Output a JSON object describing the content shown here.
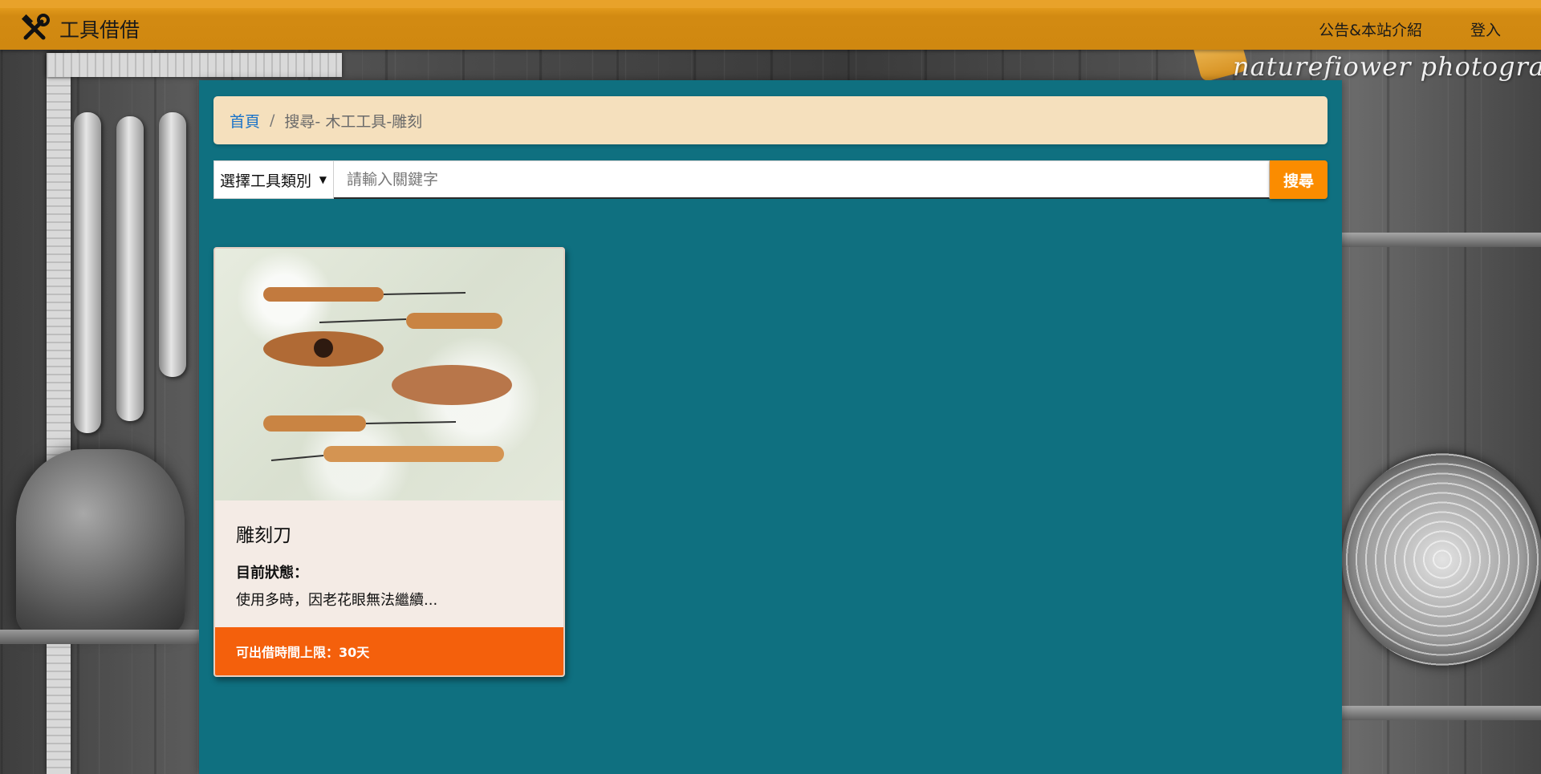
{
  "navbar": {
    "brand": "工具借借",
    "links": {
      "announcements": "公告&本站介紹",
      "login": "登入"
    }
  },
  "watermark": "naturefiower photography",
  "breadcrumb": {
    "home": "首頁",
    "separator": "/",
    "current": "搜尋- 木工工具-雕刻"
  },
  "search": {
    "category_label": "選擇工具類別",
    "caret": "▼",
    "placeholder": "請輸入關鍵字",
    "value": "",
    "button_label": "搜尋"
  },
  "results": [
    {
      "title": "雕刻刀",
      "status_label": "目前狀態：",
      "status_text": "使用多時，因老花眼無法繼續...",
      "footer": "可出借時間上限：30天",
      "image_icon": "wood-carving-tools-photo"
    }
  ],
  "colors": {
    "navbar": "#d08810",
    "panel": "#0f7080",
    "breadcrumb_bg": "#f5e0bd",
    "search_button": "#fb8c00",
    "card_footer": "#f4600c"
  }
}
